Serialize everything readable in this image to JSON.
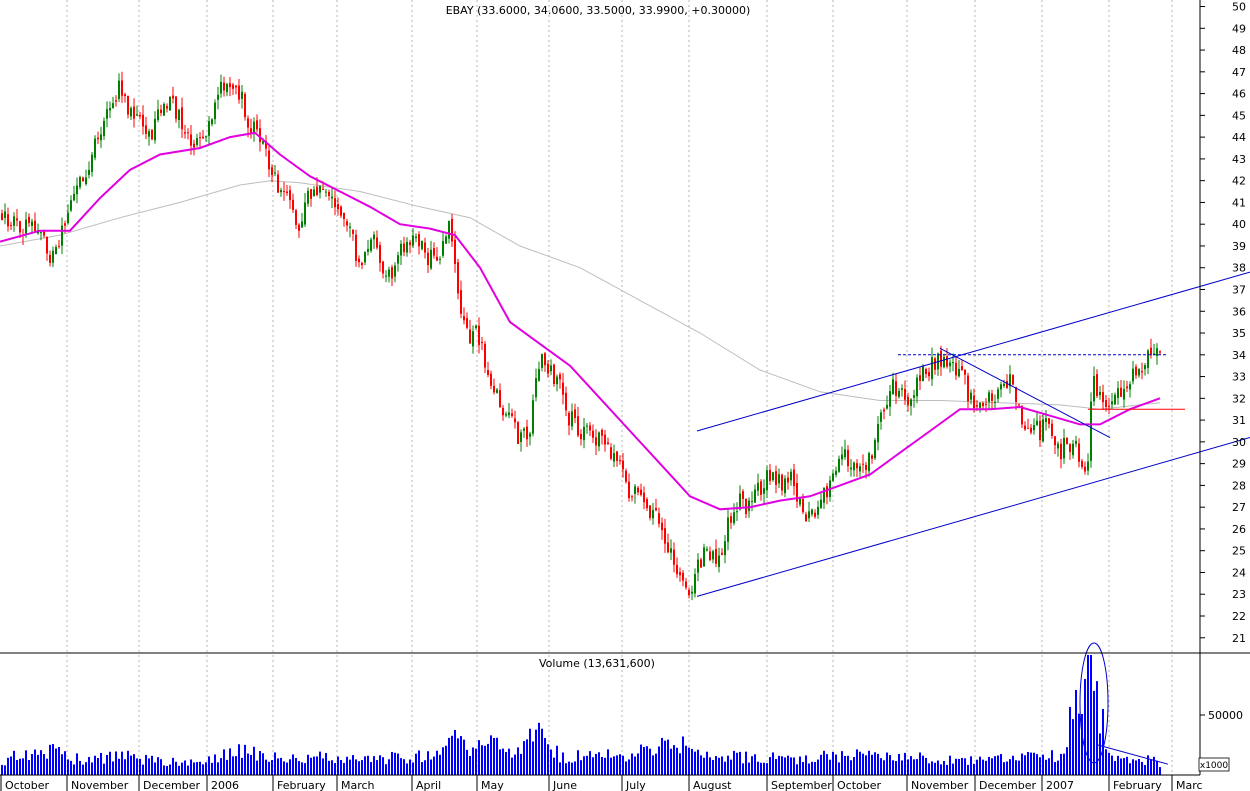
{
  "chart_data": {
    "type": "candlestick",
    "title": "EBAY (33.6000, 34.0600, 33.5000, 33.9900, +0.30000)",
    "volume_title": "Volume (13,631,600)",
    "volume_unit": "x1000",
    "price_axis": {
      "ylim": [
        20.3,
        50.3
      ],
      "ticks": [
        21,
        22,
        23,
        24,
        25,
        26,
        27,
        28,
        29,
        30,
        31,
        32,
        33,
        34,
        35,
        36,
        37,
        38,
        39,
        40,
        41,
        42,
        43,
        44,
        45,
        46,
        47,
        48,
        49,
        50
      ]
    },
    "volume_axis": {
      "ylim": [
        0,
        100000
      ],
      "ticks": [
        50000
      ]
    },
    "month_labels": [
      "October",
      "November",
      "December",
      "2006",
      "February",
      "March",
      "April",
      "May",
      "June",
      "July",
      "August",
      "September",
      "October",
      "November",
      "December",
      "2007",
      "February",
      "Marc"
    ],
    "price_anchors": [
      [
        0,
        40.5
      ],
      [
        10,
        40.2
      ],
      [
        20,
        39.8
      ],
      [
        30,
        40.2
      ],
      [
        40,
        39.3
      ],
      [
        50,
        38.5
      ],
      [
        60,
        39.5
      ],
      [
        70,
        40.5
      ],
      [
        80,
        42.0
      ],
      [
        90,
        43.0
      ],
      [
        100,
        44.0
      ],
      [
        110,
        45.5
      ],
      [
        120,
        46.5
      ],
      [
        130,
        45.0
      ],
      [
        140,
        44.5
      ],
      [
        150,
        44.0
      ],
      [
        160,
        45.0
      ],
      [
        170,
        45.8
      ],
      [
        180,
        44.8
      ],
      [
        190,
        44.0
      ],
      [
        200,
        44.0
      ],
      [
        210,
        44.5
      ],
      [
        220,
        46.0
      ],
      [
        230,
        46.5
      ],
      [
        240,
        46.0
      ],
      [
        250,
        44.5
      ],
      [
        260,
        43.8
      ],
      [
        270,
        42.5
      ],
      [
        280,
        41.5
      ],
      [
        290,
        40.8
      ],
      [
        300,
        40.0
      ],
      [
        310,
        41.5
      ],
      [
        320,
        41.5
      ],
      [
        330,
        41.0
      ],
      [
        340,
        40.2
      ],
      [
        350,
        39.8
      ],
      [
        360,
        38.0
      ],
      [
        370,
        39.5
      ],
      [
        380,
        38.5
      ],
      [
        390,
        37.5
      ],
      [
        400,
        39.0
      ],
      [
        410,
        39.5
      ],
      [
        420,
        39.0
      ],
      [
        430,
        38.5
      ],
      [
        440,
        38.5
      ],
      [
        450,
        40.0
      ],
      [
        460,
        35.5
      ],
      [
        470,
        35.0
      ],
      [
        480,
        34.8
      ],
      [
        490,
        33.0
      ],
      [
        500,
        32.0
      ],
      [
        510,
        31.0
      ],
      [
        520,
        30.0
      ],
      [
        530,
        30.5
      ],
      [
        540,
        34.0
      ],
      [
        550,
        33.5
      ],
      [
        560,
        32.5
      ],
      [
        570,
        31.0
      ],
      [
        580,
        30.5
      ],
      [
        590,
        30.5
      ],
      [
        600,
        30.0
      ],
      [
        610,
        29.5
      ],
      [
        620,
        29.0
      ],
      [
        630,
        27.5
      ],
      [
        640,
        27.5
      ],
      [
        650,
        27.0
      ],
      [
        660,
        26.0
      ],
      [
        670,
        24.8
      ],
      [
        680,
        24.2
      ],
      [
        690,
        23.2
      ],
      [
        700,
        24.5
      ],
      [
        710,
        25.0
      ],
      [
        720,
        24.5
      ],
      [
        730,
        26.5
      ],
      [
        740,
        27.3
      ],
      [
        750,
        27.0
      ],
      [
        760,
        28.0
      ],
      [
        770,
        28.5
      ],
      [
        780,
        28.2
      ],
      [
        790,
        28.5
      ],
      [
        800,
        27.0
      ],
      [
        810,
        26.5
      ],
      [
        820,
        27.5
      ],
      [
        830,
        28.0
      ],
      [
        840,
        29.5
      ],
      [
        850,
        29.0
      ],
      [
        860,
        29.0
      ],
      [
        870,
        29.0
      ],
      [
        880,
        31.0
      ],
      [
        890,
        32.5
      ],
      [
        900,
        32.3
      ],
      [
        910,
        32.0
      ],
      [
        920,
        33.0
      ],
      [
        930,
        33.5
      ],
      [
        940,
        34.0
      ],
      [
        950,
        33.5
      ],
      [
        960,
        33.5
      ],
      [
        970,
        32.0
      ],
      [
        980,
        31.8
      ],
      [
        990,
        31.8
      ],
      [
        1000,
        32.5
      ],
      [
        1010,
        32.8
      ],
      [
        1020,
        31.5
      ],
      [
        1030,
        30.5
      ],
      [
        1040,
        30.5
      ],
      [
        1050,
        30.8
      ],
      [
        1060,
        29.5
      ],
      [
        1070,
        30.0
      ],
      [
        1080,
        29.5
      ],
      [
        1085,
        28.8
      ],
      [
        1090,
        30.0
      ],
      [
        1092,
        33.5
      ],
      [
        1100,
        31.8
      ],
      [
        1110,
        32.0
      ],
      [
        1120,
        32.5
      ],
      [
        1130,
        33.0
      ],
      [
        1140,
        33.5
      ],
      [
        1150,
        33.8
      ],
      [
        1160,
        34.0
      ]
    ],
    "ma_fast": [
      [
        0,
        39.2
      ],
      [
        40,
        39.7
      ],
      [
        70,
        39.7
      ],
      [
        100,
        41.2
      ],
      [
        130,
        42.5
      ],
      [
        160,
        43.2
      ],
      [
        200,
        43.5
      ],
      [
        230,
        44.0
      ],
      [
        255,
        44.2
      ],
      [
        280,
        43.2
      ],
      [
        310,
        42.2
      ],
      [
        340,
        41.5
      ],
      [
        370,
        40.8
      ],
      [
        400,
        40.0
      ],
      [
        430,
        39.8
      ],
      [
        455,
        39.5
      ],
      [
        480,
        38.0
      ],
      [
        510,
        35.5
      ],
      [
        540,
        34.5
      ],
      [
        570,
        33.5
      ],
      [
        600,
        32.0
      ],
      [
        630,
        30.5
      ],
      [
        660,
        29.0
      ],
      [
        690,
        27.5
      ],
      [
        720,
        26.9
      ],
      [
        750,
        27.0
      ],
      [
        780,
        27.3
      ],
      [
        810,
        27.5
      ],
      [
        840,
        28.0
      ],
      [
        870,
        28.5
      ],
      [
        900,
        29.5
      ],
      [
        930,
        30.5
      ],
      [
        960,
        31.5
      ],
      [
        990,
        31.5
      ],
      [
        1020,
        31.6
      ],
      [
        1050,
        31.2
      ],
      [
        1080,
        30.8
      ],
      [
        1100,
        30.8
      ],
      [
        1130,
        31.5
      ],
      [
        1160,
        32.0
      ]
    ],
    "ma_slow": [
      [
        0,
        39.0
      ],
      [
        60,
        39.5
      ],
      [
        120,
        40.3
      ],
      [
        180,
        41.0
      ],
      [
        240,
        41.8
      ],
      [
        270,
        42.0
      ],
      [
        300,
        41.9
      ],
      [
        360,
        41.5
      ],
      [
        420,
        40.8
      ],
      [
        470,
        40.3
      ],
      [
        520,
        39.0
      ],
      [
        580,
        38.0
      ],
      [
        640,
        36.5
      ],
      [
        700,
        35.0
      ],
      [
        760,
        33.3
      ],
      [
        820,
        32.3
      ],
      [
        880,
        31.9
      ],
      [
        940,
        31.9
      ],
      [
        1000,
        31.8
      ],
      [
        1060,
        31.7
      ],
      [
        1100,
        31.5
      ],
      [
        1160,
        31.8
      ]
    ],
    "volume_profile": [
      [
        0,
        12000
      ],
      [
        40,
        26000
      ],
      [
        80,
        14000
      ],
      [
        120,
        17000
      ],
      [
        160,
        13000
      ],
      [
        200,
        11000
      ],
      [
        240,
        24000
      ],
      [
        280,
        14000
      ],
      [
        320,
        17000
      ],
      [
        360,
        13000
      ],
      [
        400,
        16000
      ],
      [
        440,
        22000
      ],
      [
        455,
        40000
      ],
      [
        470,
        18000
      ],
      [
        490,
        38000
      ],
      [
        510,
        22000
      ],
      [
        540,
        38000
      ],
      [
        560,
        18000
      ],
      [
        600,
        16000
      ],
      [
        640,
        22000
      ],
      [
        680,
        27000
      ],
      [
        700,
        19000
      ],
      [
        740,
        17000
      ],
      [
        800,
        15000
      ],
      [
        860,
        18000
      ],
      [
        900,
        16000
      ],
      [
        960,
        15000
      ],
      [
        1000,
        14000
      ],
      [
        1040,
        16000
      ],
      [
        1060,
        20000
      ],
      [
        1090,
        100000
      ],
      [
        1110,
        18000
      ],
      [
        1160,
        12000
      ]
    ],
    "annotations": {
      "channel_upper": [
        [
          697,
          30.5
        ],
        [
          1250,
          37.8
        ]
      ],
      "channel_lower": [
        [
          697,
          22.9
        ],
        [
          1250,
          30.2
        ]
      ],
      "resistance_34": [
        [
          898,
          34.0
        ],
        [
          1168,
          34.0
        ]
      ],
      "downtrend": [
        [
          940,
          34.3
        ],
        [
          1110,
          30.2
        ]
      ],
      "support_red": [
        [
          1088,
          31.5
        ],
        [
          1185,
          31.5
        ]
      ],
      "volume_trend": [
        [
          1098,
          25000
        ],
        [
          1168,
          9000
        ]
      ],
      "volume_ellipse": [
        1094,
        60000,
        14,
        50000
      ]
    }
  }
}
